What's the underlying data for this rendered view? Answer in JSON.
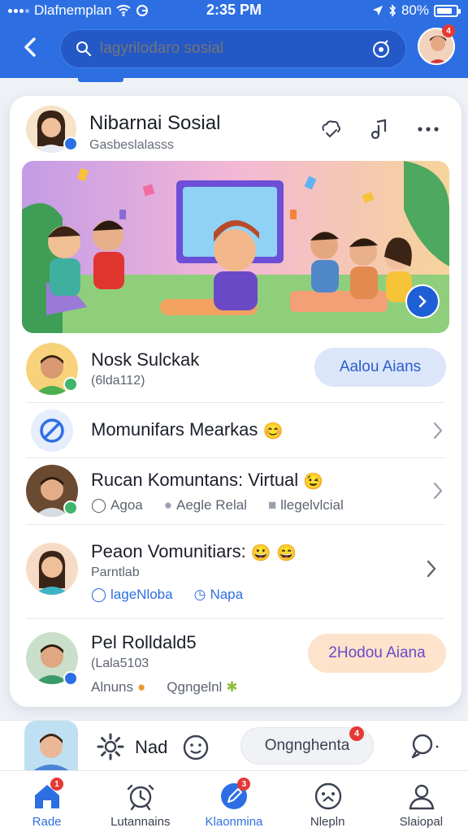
{
  "status_bar": {
    "carrier": "Dlafnemplan",
    "time": "2:35 PM",
    "battery": "80%"
  },
  "header": {
    "search_placeholder": "lagyrilodaro sosial",
    "notification_count": "4"
  },
  "post": {
    "author_name": "Nibarnai Sosial",
    "author_handle": "Gasbeslalasss",
    "icons": [
      "share-icon",
      "music-note-icon",
      "more-icon"
    ]
  },
  "rows": [
    {
      "title": "Nosk Sulckak",
      "subtitle": "(6lda112)",
      "button_label": "Aalou Aians"
    },
    {
      "title": "Momunifars Mearkas"
    },
    {
      "title": "Rucan Komuntans: Virtual",
      "tags": [
        "Agoa",
        "Aegle Relal",
        "llegelvlcial"
      ]
    },
    {
      "title": "Peaon Vomunitiars:",
      "subtitle": "Parntlab",
      "tags": [
        "lageNloba",
        "Napa"
      ]
    },
    {
      "title": "Pel Rolldald5",
      "subtitle": "(Lala5103",
      "button_label": "2Hodou Aiana",
      "tags": [
        "Alnuns",
        "Qgngelnl"
      ]
    }
  ],
  "composer": {
    "label": "Nad",
    "pill_label": "Ongnghenta",
    "badge_count": "4"
  },
  "bottom_nav": {
    "items": [
      {
        "label": "Rade",
        "badge": "1",
        "active": true
      },
      {
        "label": "Lutannains",
        "badge": "",
        "active": false
      },
      {
        "label": "Klaonmina",
        "badge": "3",
        "active": true
      },
      {
        "label": "Nlepln",
        "badge": "",
        "active": false
      },
      {
        "label": "Slaiopal",
        "badge": "",
        "active": false
      }
    ]
  },
  "colors": {
    "primary": "#2d6fe3",
    "button_blue_bg": "#dbe6fb",
    "button_orange_bg": "#fde3cc",
    "badge_red": "#e53935"
  }
}
